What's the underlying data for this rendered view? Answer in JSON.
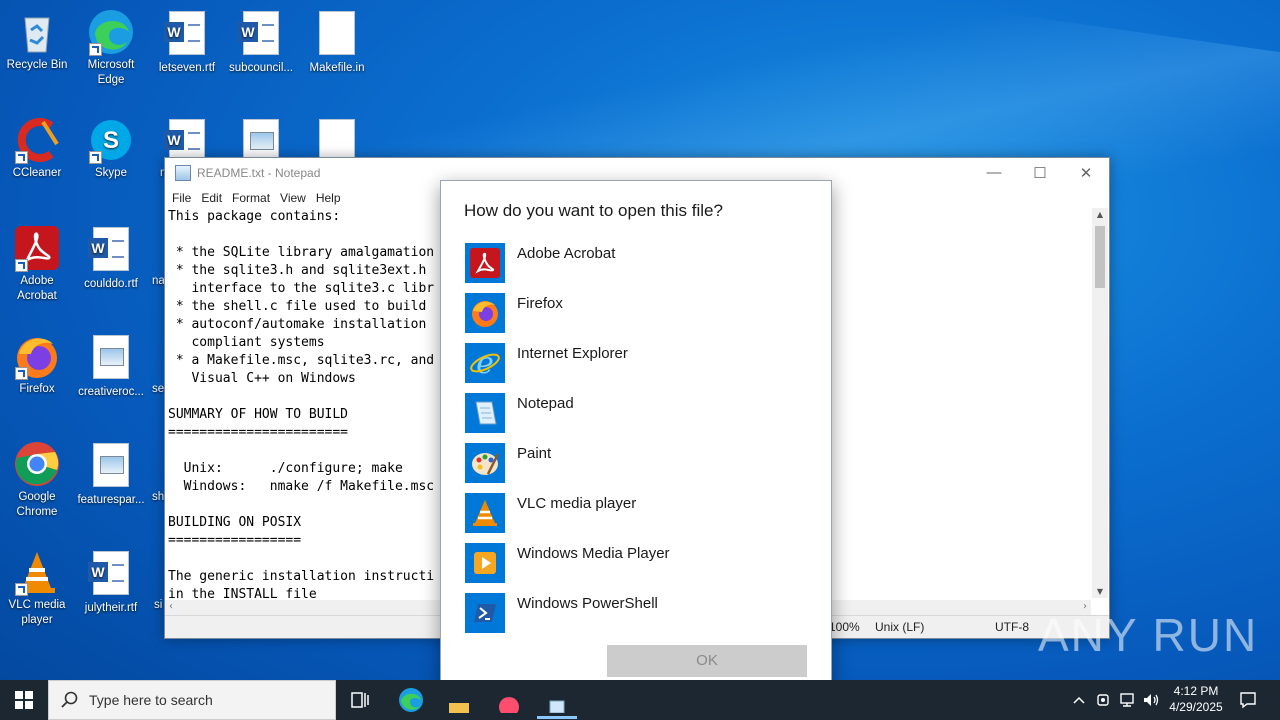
{
  "desktop": {
    "icons": [
      {
        "label": "Recycle Bin"
      },
      {
        "label": "Microsoft Edge"
      },
      {
        "label": "letseven.rtf"
      },
      {
        "label": "subcouncil..."
      },
      {
        "label": "Makefile.in"
      },
      {
        "label": "CCleaner"
      },
      {
        "label": "Skype"
      },
      {
        "label": "Adobe Acrobat"
      },
      {
        "label": "coulddo.rtf"
      },
      {
        "label": "Firefox"
      },
      {
        "label": "creativeroc..."
      },
      {
        "label": "Google Chrome"
      },
      {
        "label": "featurespar..."
      },
      {
        "label": "VLC media player"
      },
      {
        "label": "julytheir.rtf"
      }
    ],
    "partial_labels": [
      "m",
      "na",
      "se",
      "sh",
      "si"
    ]
  },
  "notepad": {
    "title": "README.txt - Notepad",
    "menu": [
      "File",
      "Edit",
      "Format",
      "View",
      "Help"
    ],
    "content": "This package contains:\n\n * the SQLite library amalgamation\n * the sqlite3.h and sqlite3ext.h\n   interface to the sqlite3.c libr\n * the shell.c file used to build\n * autoconf/automake installation\n   compliant systems\n * a Makefile.msc, sqlite3.rc, and\n   Visual C++ on Windows\n\nSUMMARY OF HOW TO BUILD\n=======================\n\n  Unix:      ./configure; make\n  Windows:   nmake /f Makefile.msc\n\nBUILDING ON POSIX\n=================\n\nThe generic installation instructi\nin the INSTALL file",
    "status": {
      "zoom": "100%",
      "line_ending": "Unix (LF)",
      "encoding": "UTF-8"
    }
  },
  "dialog": {
    "title": "How do you want to open this file?",
    "apps": [
      {
        "label": "Adobe Acrobat",
        "icon": "acrobat-icon"
      },
      {
        "label": "Firefox",
        "icon": "firefox-icon"
      },
      {
        "label": "Internet Explorer",
        "icon": "ie-icon"
      },
      {
        "label": "Notepad",
        "icon": "notepad-icon"
      },
      {
        "label": "Paint",
        "icon": "paint-icon"
      },
      {
        "label": "VLC media player",
        "icon": "vlc-icon"
      },
      {
        "label": "Windows Media Player",
        "icon": "wmp-icon"
      },
      {
        "label": "Windows PowerShell",
        "icon": "powershell-icon"
      }
    ],
    "ok_label": "OK"
  },
  "taskbar": {
    "search_placeholder": "Type here to search",
    "time": "4:12 PM",
    "date": "4/29/2025"
  },
  "watermark": "ANY RUN",
  "colors": {
    "accent": "#0078d7",
    "taskbar": "#1c2731",
    "desktop": "#0b6fd0"
  }
}
